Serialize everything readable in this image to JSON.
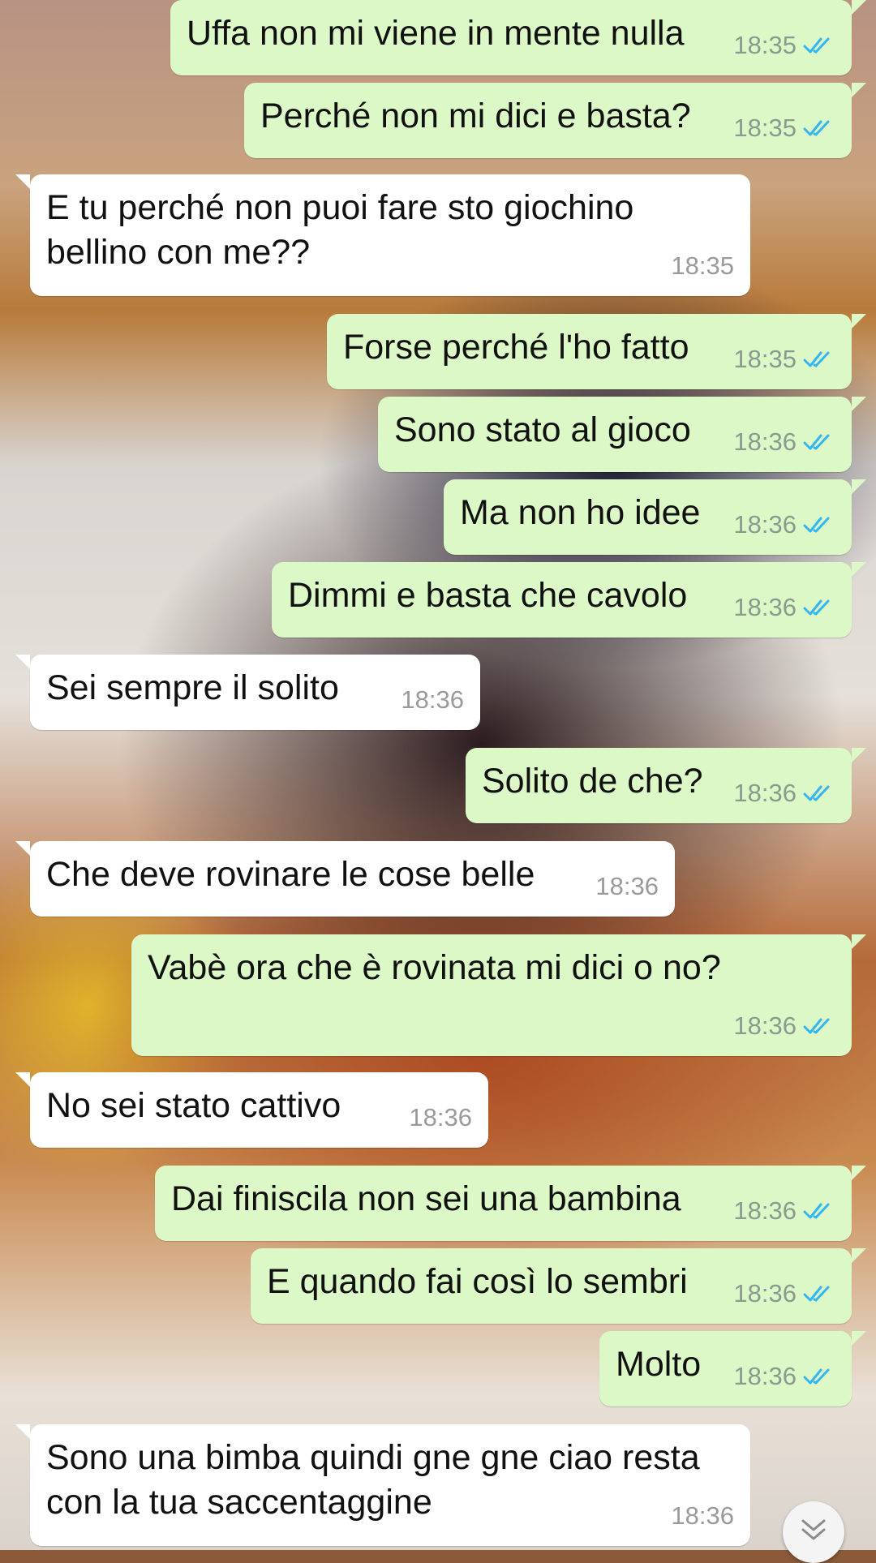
{
  "messages": [
    {
      "id": "m1",
      "direction": "outgoing",
      "text": "Uffa non mi viene in mente nulla",
      "time": "18:35",
      "status": "read"
    },
    {
      "id": "m2",
      "direction": "outgoing",
      "text": "Perché non mi dici e basta?",
      "time": "18:35",
      "status": "read"
    },
    {
      "id": "m3",
      "direction": "incoming",
      "text": "E tu perché non puoi fare sto giochino bellino con me??",
      "time": "18:35"
    },
    {
      "id": "m4",
      "direction": "outgoing",
      "text": "Forse perché l'ho fatto",
      "time": "18:35",
      "status": "read"
    },
    {
      "id": "m5",
      "direction": "outgoing",
      "text": "Sono stato al gioco",
      "time": "18:36",
      "status": "read"
    },
    {
      "id": "m6",
      "direction": "outgoing",
      "text": "Ma non ho idee",
      "time": "18:36",
      "status": "read"
    },
    {
      "id": "m7",
      "direction": "outgoing",
      "text": "Dimmi e basta che cavolo",
      "time": "18:36",
      "status": "read"
    },
    {
      "id": "m8",
      "direction": "incoming",
      "text": "Sei sempre il solito",
      "time": "18:36"
    },
    {
      "id": "m9",
      "direction": "outgoing",
      "text": "Solito de che?",
      "time": "18:36",
      "status": "read"
    },
    {
      "id": "m10",
      "direction": "incoming",
      "text": "Che deve rovinare le cose belle",
      "time": "18:36"
    },
    {
      "id": "m11",
      "direction": "outgoing",
      "text": "Vabè ora che è rovinata mi dici o no?",
      "time": "18:36",
      "status": "read"
    },
    {
      "id": "m12",
      "direction": "incoming",
      "text": "No sei stato cattivo",
      "time": "18:36"
    },
    {
      "id": "m13",
      "direction": "outgoing",
      "text": "Dai finiscila non sei una bambina",
      "time": "18:36",
      "status": "read"
    },
    {
      "id": "m14",
      "direction": "outgoing",
      "text": "E quando fai così lo sembri",
      "time": "18:36",
      "status": "read"
    },
    {
      "id": "m15",
      "direction": "outgoing",
      "text": "Molto",
      "time": "18:36",
      "status": "read"
    },
    {
      "id": "m16",
      "direction": "incoming",
      "text": "Sono una bimba quindi gne gne ciao resta con la tua saccentaggine",
      "time": "18:36"
    }
  ],
  "colors": {
    "outgoing_bubble": "#dcf8c6",
    "incoming_bubble": "#ffffff",
    "read_ticks": "#34b7f1"
  },
  "icons": {
    "read_status": "double-check-icon",
    "scroll_down": "double-chevron-down-icon"
  }
}
